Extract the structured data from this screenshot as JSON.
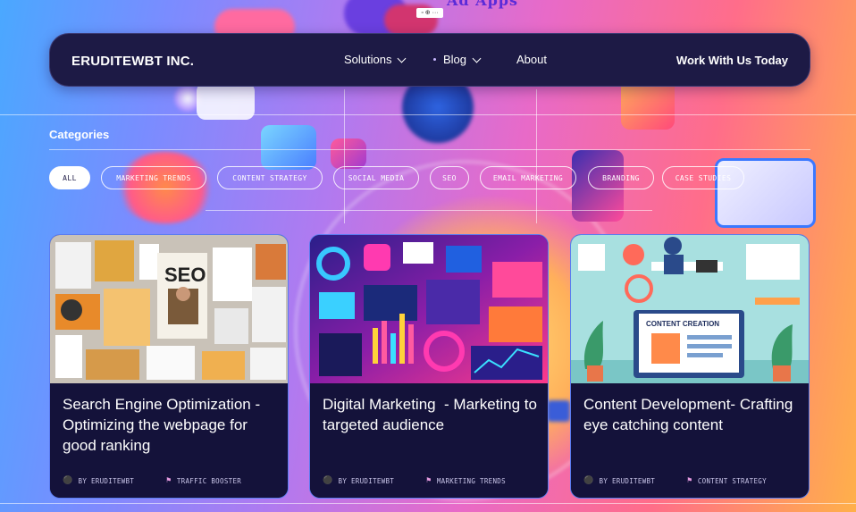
{
  "background": {
    "top_label": "Ad Apps",
    "mini_toolbar": "▫ ⊕ ···"
  },
  "navbar": {
    "brand": "ERUDITEWBT INC.",
    "items": [
      {
        "label": "Solutions",
        "has_dropdown": true
      },
      {
        "label": "Blog",
        "has_dropdown": true
      },
      {
        "label": "About",
        "has_dropdown": false
      }
    ],
    "cta": "Work With Us Today"
  },
  "categories": {
    "title": "Categories",
    "chips": [
      {
        "label": "ALL",
        "active": true
      },
      {
        "label": "MARKETING TRENDS",
        "active": false
      },
      {
        "label": "CONTENT STRATEGY",
        "active": false
      },
      {
        "label": "SOCIAL MEDIA",
        "active": false
      },
      {
        "label": "SEO",
        "active": false
      },
      {
        "label": "EMAIL MARKETING",
        "active": false
      },
      {
        "label": "BRANDING",
        "active": false
      },
      {
        "label": "CASE STUDIES",
        "active": false
      }
    ]
  },
  "posts": [
    {
      "title": "Search Engine Optimization - Optimizing the webpage for good ranking",
      "author": "BY ERUDITEWBT",
      "tag": "TRAFFIC BOOSTER",
      "image_label": "SEO"
    },
    {
      "title": "Digital Marketing  - Marketing to targeted audience",
      "author": "BY ERUDITEWBT",
      "tag": "MARKETING TRENDS",
      "image_label": ""
    },
    {
      "title": "Content Development- Crafting eye catching content",
      "author": "BY ERUDITEWBT",
      "tag": "CONTENT STRATEGY",
      "image_label": "CONTENT CREATION"
    }
  ],
  "colors": {
    "nav_bg": "#1d1a45",
    "card_bg": "#14123a",
    "card_border": "#5a7cf0",
    "meta_icon": "#e59adf"
  },
  "icons": [
    "person-icon",
    "tag-icon",
    "chevron-down-icon"
  ]
}
